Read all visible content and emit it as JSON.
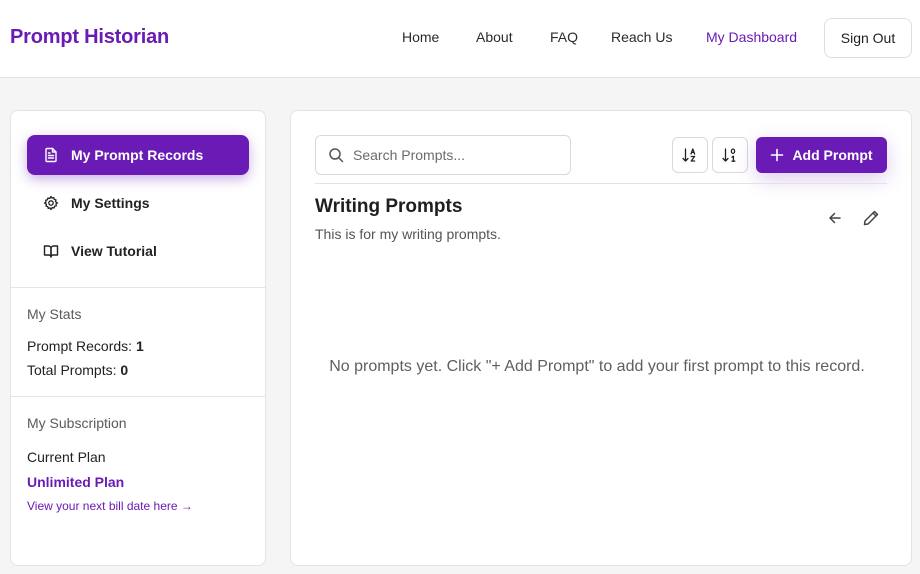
{
  "header": {
    "brand": "Prompt Historian",
    "nav": {
      "home": "Home",
      "about": "About",
      "faq": "FAQ",
      "reach_us": "Reach Us",
      "dashboard": "My Dashboard"
    },
    "sign_out": "Sign Out"
  },
  "sidebar": {
    "items": [
      {
        "label": "My Prompt Records",
        "icon": "document-icon",
        "active": true
      },
      {
        "label": "My Settings",
        "icon": "gear-icon",
        "active": false
      },
      {
        "label": "View Tutorial",
        "icon": "book-icon",
        "active": false
      }
    ],
    "stats": {
      "title": "My Stats",
      "prompt_records_label": "Prompt Records: ",
      "prompt_records_value": "1",
      "total_prompts_label": "Total Prompts: ",
      "total_prompts_value": "0"
    },
    "subscription": {
      "title": "My Subscription",
      "current_plan_label": "Current Plan",
      "plan_name": "Unlimited Plan",
      "bill_link": "View your next bill date here →"
    }
  },
  "main": {
    "search_placeholder": "Search Prompts...",
    "sort_az_icon": "sort-alpha-icon",
    "sort_numeric_icon": "sort-numeric-icon",
    "add_button": "Add Prompt",
    "record": {
      "title": "Writing Prompts",
      "description": "This is for my writing prompts."
    },
    "empty_message": "No prompts yet. Click \"+ Add Prompt\" to add your first prompt to this record."
  },
  "colors": {
    "accent": "#6a1bb5",
    "background": "#f5f5f5",
    "panel": "#ffffff",
    "border": "#e3e3e3"
  }
}
